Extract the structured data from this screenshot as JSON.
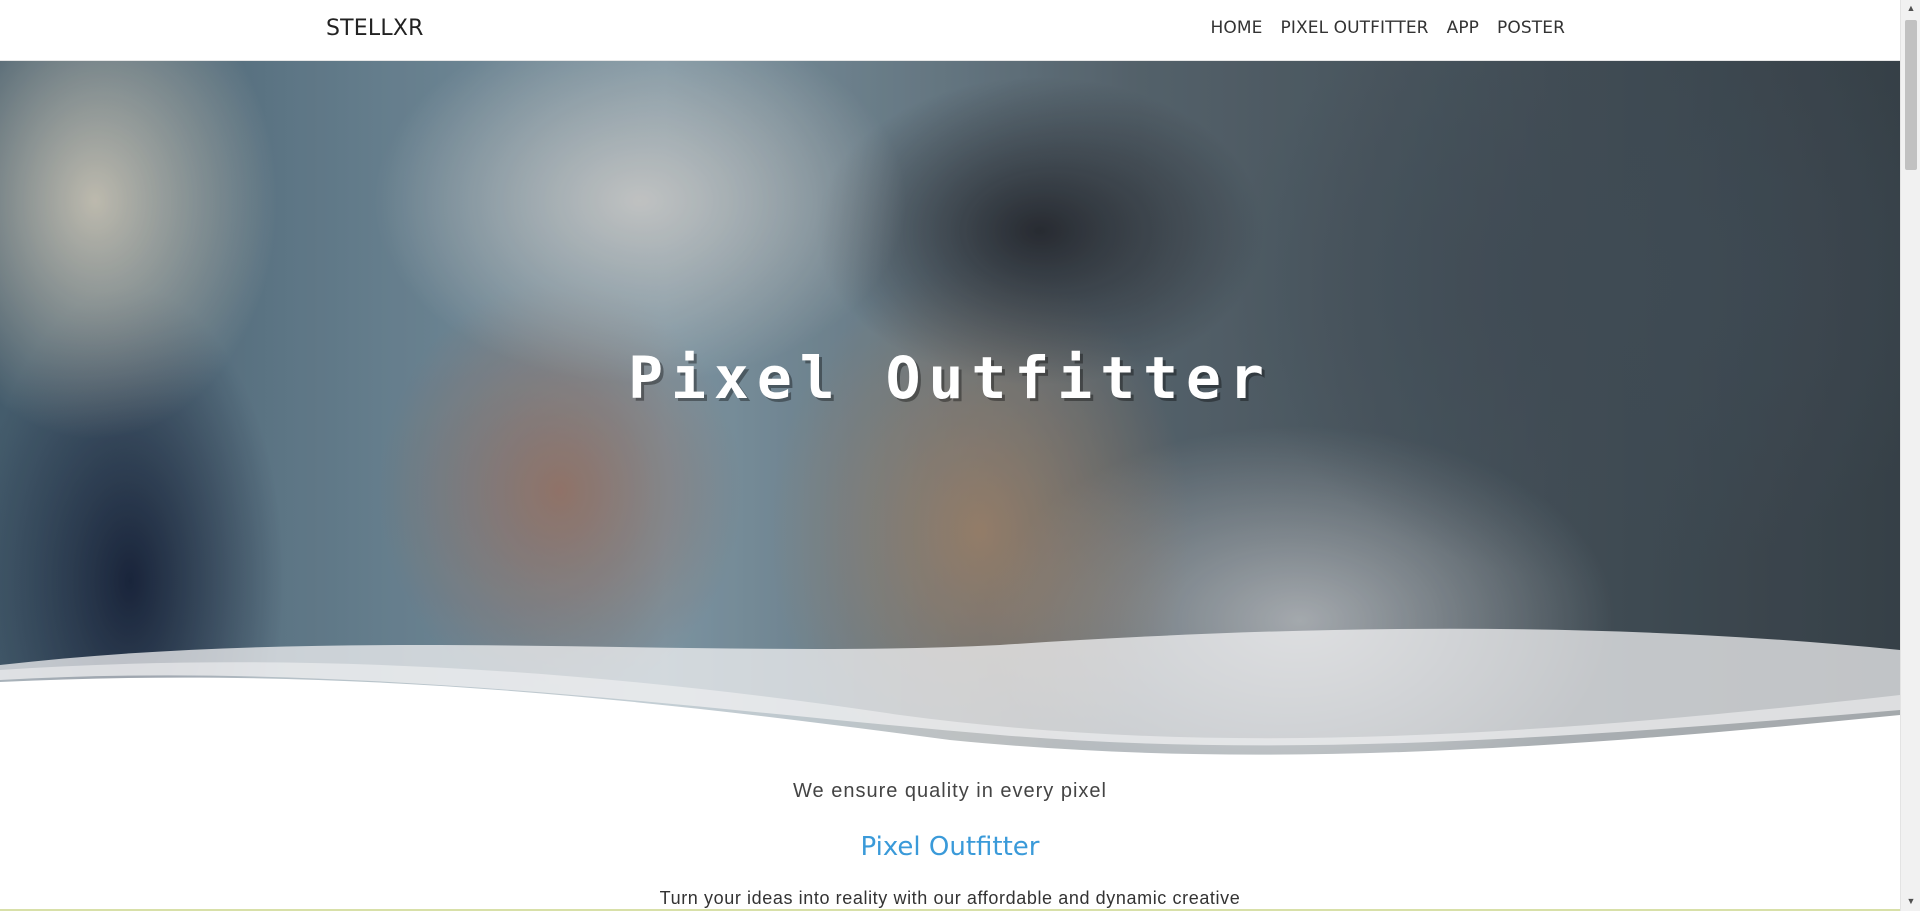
{
  "navbar": {
    "brand": "STELLXR",
    "items": [
      {
        "label": "HOME"
      },
      {
        "label": "PIXEL OUTFITTER"
      },
      {
        "label": "APP"
      },
      {
        "label": "POSTER"
      }
    ]
  },
  "hero": {
    "title": "Pixel Outfitter"
  },
  "intro": {
    "tagline": "We ensure quality in every pixel",
    "section_title": "Pixel Outfitter",
    "description": "Turn your ideas into reality with our affordable and dynamic creative"
  },
  "colors": {
    "accent": "#3a9ad9",
    "nav_text": "#333333",
    "background": "#ffffff"
  },
  "icons": {
    "scroll_up": "chevron-up-icon",
    "scroll_down": "chevron-down-icon"
  }
}
